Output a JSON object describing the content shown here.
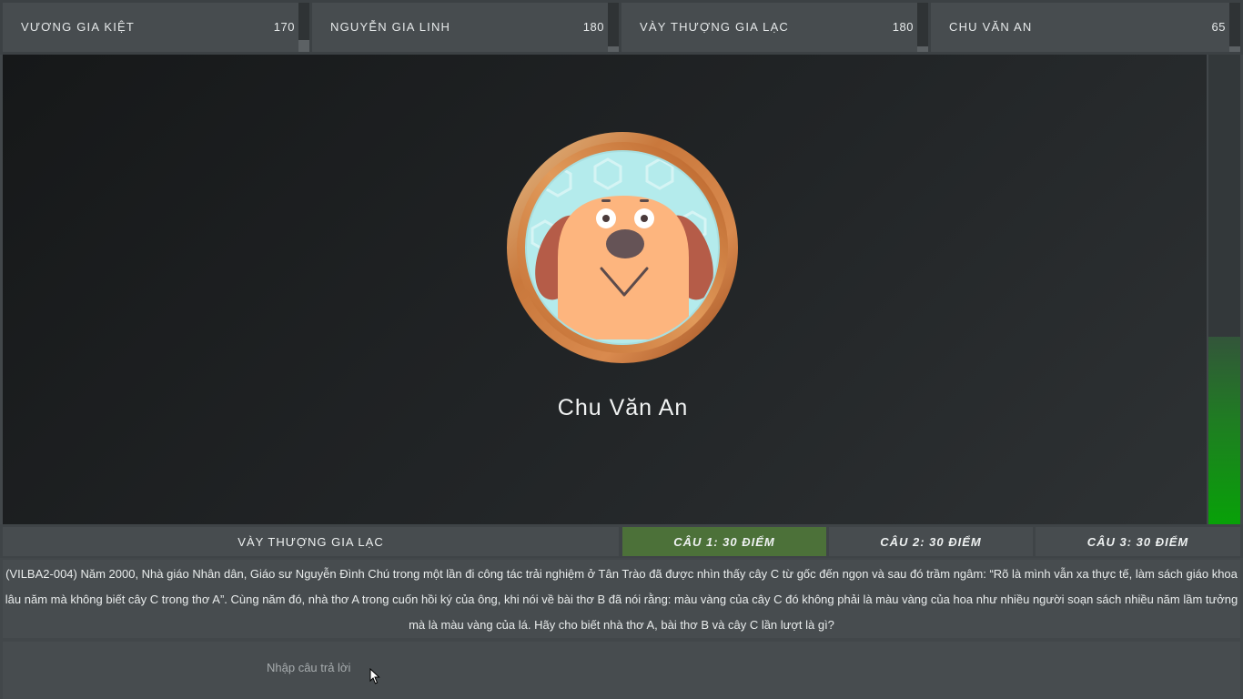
{
  "players": [
    {
      "name": "VƯƠNG GIA KIỆT",
      "score": "170",
      "level": 0.25
    },
    {
      "name": "NGUYỄN GIA LINH",
      "score": "180",
      "level": 0.12
    },
    {
      "name": "VÀY THƯỢNG GIA LẠC",
      "score": "180",
      "level": 0.12
    },
    {
      "name": "CHU VĂN AN",
      "score": "65",
      "level": 0.12
    }
  ],
  "stage": {
    "current_player": "Chu Văn An",
    "avatar_icon": "dog-face-icon",
    "timer_level": 0.4
  },
  "question_header": {
    "asker": "VÀY THƯỢNG GIA LẠC",
    "tabs": [
      {
        "label": "CÂU 1: 30 ĐIỂM",
        "active": true
      },
      {
        "label": "CÂU 2: 30 ĐIỂM",
        "active": false
      },
      {
        "label": "CÂU 3: 30 ĐIỂM",
        "active": false
      }
    ]
  },
  "question": {
    "text": "(VILBA2-004) Năm 2000, Nhà giáo Nhân dân, Giáo sư Nguyễn Đình Chú trong một lần đi công tác trải nghiệm ở Tân Trào đã được nhìn thấy cây C từ gốc đến ngọn và sau đó trầm ngâm: “Rõ là mình vẫn xa thực tế, làm sách giáo khoa lâu năm mà không biết cây C trong thơ A”. Cùng năm đó, nhà thơ A trong cuốn hồi ký của ông, khi nói về bài thơ B đã nói rằng: màu vàng của cây C đó không phải là màu vàng của hoa như nhiều người soạn sách nhiều năm lầm tưởng mà là màu vàng của lá. Hãy cho biết nhà thơ A, bài thơ B và cây C lần lượt là gì?"
  },
  "answer": {
    "placeholder": "Nhập câu trả lời",
    "value": ""
  },
  "colors": {
    "active_tab": "#4c7139",
    "timer_green": "#08a108",
    "panel": "#474c4f"
  }
}
